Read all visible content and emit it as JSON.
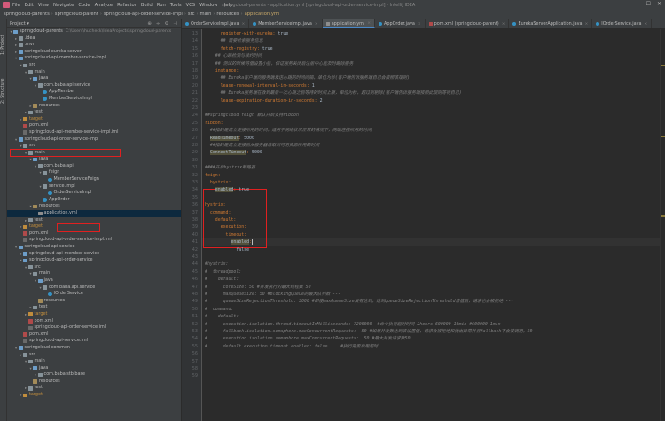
{
  "menu": {
    "items": [
      "File",
      "Edit",
      "View",
      "Navigate",
      "Code",
      "Analyze",
      "Refactor",
      "Build",
      "Run",
      "Tools",
      "VCS",
      "Window",
      "Help"
    ],
    "window_title": "springcloud-parents - application.yml [springcloud-api-order-service-impl] - IntelliJ IDEA",
    "controls": [
      "—",
      "☐",
      "✕"
    ]
  },
  "nav": {
    "crumbs": [
      "springcloud-parents",
      "springcloud-parent",
      "springcloud-api-order-service-impl",
      "src",
      "main",
      "resources",
      "application.yml"
    ]
  },
  "side": {
    "tabs": [
      "1: Project",
      "2: Structure"
    ]
  },
  "project": {
    "title": "Project ▾",
    "tools": [
      "⊕",
      "÷",
      "⚙",
      "⊣"
    ],
    "tree": [
      {
        "d": 0,
        "arr": "▾",
        "ic": "module",
        "label": "springcloud-parents",
        "gray": "C:\\Users\\hucheck\\IdeaProjects\\springcloud-parents"
      },
      {
        "d": 1,
        "arr": "▸",
        "ic": "folder",
        "label": ".idea"
      },
      {
        "d": 1,
        "arr": "▸",
        "ic": "folder",
        "label": ".mvn"
      },
      {
        "d": 1,
        "arr": "▸",
        "ic": "module",
        "label": "springcloud-eureka-server"
      },
      {
        "d": 1,
        "arr": "▾",
        "ic": "module",
        "label": "springcloud-api-member-service-impl"
      },
      {
        "d": 2,
        "arr": "▾",
        "ic": "folder",
        "label": "src"
      },
      {
        "d": 3,
        "arr": "▾",
        "ic": "folder",
        "label": "main"
      },
      {
        "d": 4,
        "arr": "▾",
        "ic": "src",
        "label": "java"
      },
      {
        "d": 5,
        "arr": "▾",
        "ic": "pkg",
        "label": "com.baba.api.service"
      },
      {
        "d": 6,
        "arr": "",
        "ic": "cls",
        "label": "AppMember"
      },
      {
        "d": 6,
        "arr": "",
        "ic": "cls",
        "label": "MemberServiceImpl"
      },
      {
        "d": 4,
        "arr": "▸",
        "ic": "res",
        "label": "resources"
      },
      {
        "d": 3,
        "arr": "▸",
        "ic": "folder",
        "label": "test"
      },
      {
        "d": 2,
        "arr": "▸",
        "ic": "tgt",
        "label": "target",
        "orange": true
      },
      {
        "d": 2,
        "arr": "",
        "ic": "pom",
        "label": "pom.xml"
      },
      {
        "d": 2,
        "arr": "",
        "ic": "iml",
        "label": "springcloud-api-member-service-impl.iml"
      },
      {
        "d": 1,
        "arr": "▾",
        "ic": "module",
        "label": "springcloud-api-order-service-impl",
        "sel": true
      },
      {
        "d": 2,
        "arr": "▾",
        "ic": "folder",
        "label": "src"
      },
      {
        "d": 3,
        "arr": "▾",
        "ic": "folder",
        "label": "main"
      },
      {
        "d": 4,
        "arr": "▾",
        "ic": "src",
        "label": "java"
      },
      {
        "d": 5,
        "arr": "▾",
        "ic": "pkg",
        "label": "com.baba.api"
      },
      {
        "d": 6,
        "arr": "▾",
        "ic": "pkg",
        "label": "feign"
      },
      {
        "d": 7,
        "arr": "",
        "ic": "cls",
        "label": "MemberServiceFeign"
      },
      {
        "d": 6,
        "arr": "▾",
        "ic": "pkg",
        "label": "service.impl"
      },
      {
        "d": 7,
        "arr": "",
        "ic": "cls",
        "label": "OrderServiceImpl"
      },
      {
        "d": 6,
        "arr": "",
        "ic": "cls",
        "label": "AppOrder"
      },
      {
        "d": 4,
        "arr": "▾",
        "ic": "res",
        "label": "resources"
      },
      {
        "d": 5,
        "arr": "",
        "ic": "yml",
        "label": "application.yml",
        "cur": true
      },
      {
        "d": 3,
        "arr": "▸",
        "ic": "folder",
        "label": "test"
      },
      {
        "d": 2,
        "arr": "▸",
        "ic": "tgt",
        "label": "target",
        "orange": true
      },
      {
        "d": 2,
        "arr": "",
        "ic": "pom",
        "label": "pom.xml"
      },
      {
        "d": 2,
        "arr": "",
        "ic": "iml",
        "label": "springcloud-api-order-service-impl.iml"
      },
      {
        "d": 1,
        "arr": "▾",
        "ic": "module",
        "label": "springcloud-api-service"
      },
      {
        "d": 2,
        "arr": "▸",
        "ic": "module",
        "label": "springcloud-api-member-service"
      },
      {
        "d": 2,
        "arr": "▾",
        "ic": "module",
        "label": "springcloud-api-order-service"
      },
      {
        "d": 3,
        "arr": "▾",
        "ic": "folder",
        "label": "src"
      },
      {
        "d": 4,
        "arr": "▾",
        "ic": "folder",
        "label": "main"
      },
      {
        "d": 5,
        "arr": "▾",
        "ic": "src",
        "label": "java"
      },
      {
        "d": 6,
        "arr": "▾",
        "ic": "pkg",
        "label": "com.baba.api.service"
      },
      {
        "d": 7,
        "arr": "",
        "ic": "cls",
        "label": "IOrderService"
      },
      {
        "d": 5,
        "arr": "",
        "ic": "res",
        "label": "resources"
      },
      {
        "d": 4,
        "arr": "▸",
        "ic": "folder",
        "label": "test"
      },
      {
        "d": 3,
        "arr": "▸",
        "ic": "tgt",
        "label": "target",
        "orange": true
      },
      {
        "d": 3,
        "arr": "",
        "ic": "pom",
        "label": "pom.xml"
      },
      {
        "d": 3,
        "arr": "",
        "ic": "iml",
        "label": "springcloud-api-order-service.iml"
      },
      {
        "d": 2,
        "arr": "",
        "ic": "pom",
        "label": "pom.xml"
      },
      {
        "d": 2,
        "arr": "",
        "ic": "iml",
        "label": "springcloud-api-service.iml"
      },
      {
        "d": 1,
        "arr": "▾",
        "ic": "module",
        "label": "springcloud-common"
      },
      {
        "d": 2,
        "arr": "▾",
        "ic": "folder",
        "label": "src"
      },
      {
        "d": 3,
        "arr": "▾",
        "ic": "folder",
        "label": "main"
      },
      {
        "d": 4,
        "arr": "▾",
        "ic": "src",
        "label": "java"
      },
      {
        "d": 5,
        "arr": "▸",
        "ic": "pkg",
        "label": "com.baba.stb.base"
      },
      {
        "d": 4,
        "arr": "",
        "ic": "res",
        "label": "resources"
      },
      {
        "d": 3,
        "arr": "▸",
        "ic": "folder",
        "label": "test"
      },
      {
        "d": 2,
        "arr": "▸",
        "ic": "tgt",
        "label": "target",
        "orange": true
      }
    ]
  },
  "tabs": [
    {
      "label": "OrderServiceImpl.java",
      "kind": "cls"
    },
    {
      "label": "MemberServiceImpl.java",
      "kind": "cls"
    },
    {
      "label": "application.yml",
      "kind": "yml",
      "active": true
    },
    {
      "label": "AppOrder.java",
      "kind": "cls"
    },
    {
      "label": "pom.xml (springcloud-parent)",
      "kind": "pom"
    },
    {
      "label": "EurekaServerApplication.java",
      "kind": "cls"
    },
    {
      "label": "IOrderService.java",
      "kind": "cls"
    }
  ],
  "editor": {
    "current_line": 41,
    "lines": [
      {
        "n": 13,
        "s": [
          {
            "t": "      register-with-eureka: ",
            "c": "key"
          },
          {
            "t": "true",
            "c": "val"
          }
        ]
      },
      {
        "n": 14,
        "s": [
          {
            "t": "      ## 需要检索服务信息",
            "c": "cmt"
          }
        ]
      },
      {
        "n": 15,
        "s": [
          {
            "t": "      fetch-registry: ",
            "c": "key"
          },
          {
            "t": "true",
            "c": "val"
          }
        ]
      },
      {
        "n": 16,
        "s": [
          {
            "t": "    ## 心跳检测与续约时间",
            "c": "cmt"
          }
        ]
      },
      {
        "n": 17,
        "s": [
          {
            "t": "    ## 测试的时候将值设置小些，保证服务关闭后注册中心能及时踢除服务",
            "c": "cmt"
          }
        ]
      },
      {
        "n": 18,
        "s": [
          {
            "t": "    instance:",
            "c": "key"
          }
        ]
      },
      {
        "n": 19,
        "s": [
          {
            "t": "      ## Eureka客户端向服务端发送心跳的时间间隔，单位为秒(客户端告诉服务端自己会按照该规则)",
            "c": "cmt"
          }
        ]
      },
      {
        "n": 20,
        "s": [
          {
            "t": "      lease-renewal-interval-in-seconds: ",
            "c": "key"
          },
          {
            "t": "1",
            "c": "val"
          }
        ]
      },
      {
        "n": 21,
        "s": [
          {
            "t": "      ## Eureka服务端在收到最后一次心跳之后等待的时间上限，单位为秒，超过则剔除(客户端告诉服务端按照此规则等待自己)",
            "c": "cmt"
          }
        ]
      },
      {
        "n": 22,
        "s": [
          {
            "t": "      lease-expiration-duration-in-seconds: ",
            "c": "key"
          },
          {
            "t": "2",
            "c": "val"
          }
        ]
      },
      {
        "n": 23,
        "s": []
      },
      {
        "n": 24,
        "s": [
          {
            "t": "##springcloud feign 默认开启支持ribbon",
            "c": "cmt"
          }
        ]
      },
      {
        "n": 25,
        "s": [
          {
            "t": "ribbon:",
            "c": "key"
          }
        ]
      },
      {
        "n": 26,
        "s": [
          {
            "t": "  ##指的是建立连接所用的时间，适用于网络状况正常的情况下，两端连接所用的时间",
            "c": "cmt"
          }
        ]
      },
      {
        "n": 27,
        "s": [
          {
            "t": "  ",
            "c": "val"
          },
          {
            "t": "ReadTimeout",
            "c": "hl"
          },
          {
            "t": ": ",
            "c": "key"
          },
          {
            "t": "5000",
            "c": "val"
          }
        ]
      },
      {
        "n": 28,
        "s": [
          {
            "t": "  ##指的是建立连接后从服务器读取到可用资源所用的时间",
            "c": "cmt"
          }
        ]
      },
      {
        "n": 29,
        "s": [
          {
            "t": "  ",
            "c": "val"
          },
          {
            "t": "ConnectTimeout",
            "c": "hl"
          },
          {
            "t": ": ",
            "c": "key"
          },
          {
            "t": "5000",
            "c": "val"
          }
        ]
      },
      {
        "n": 30,
        "s": []
      },
      {
        "n": 31,
        "s": [
          {
            "t": "####开启hystrix断路器",
            "c": "cmt"
          }
        ]
      },
      {
        "n": 32,
        "s": [
          {
            "t": "feign:",
            "c": "key"
          }
        ]
      },
      {
        "n": 33,
        "s": [
          {
            "t": "  hystrix:",
            "c": "key"
          }
        ]
      },
      {
        "n": 34,
        "s": [
          {
            "t": "    ",
            "c": "val"
          },
          {
            "t": "enabled",
            "c": "hl"
          },
          {
            "t": ": ",
            "c": "key"
          },
          {
            "t": "true",
            "c": "val"
          }
        ]
      },
      {
        "n": 35,
        "s": []
      },
      {
        "n": 36,
        "s": [
          {
            "t": "hystrix:",
            "c": "key"
          }
        ]
      },
      {
        "n": 37,
        "s": [
          {
            "t": "  command:",
            "c": "key"
          }
        ]
      },
      {
        "n": 38,
        "s": [
          {
            "t": "    default:",
            "c": "key"
          }
        ]
      },
      {
        "n": 39,
        "s": [
          {
            "t": "      execution:",
            "c": "key"
          }
        ]
      },
      {
        "n": 40,
        "s": [
          {
            "t": "        timeout:",
            "c": "key"
          }
        ]
      },
      {
        "n": 41,
        "s": [
          {
            "t": "          ",
            "c": "val"
          },
          {
            "t": "enabled",
            "c": "hl"
          },
          {
            "t": ":",
            "c": "key"
          },
          {
            "caret": true
          }
        ]
      },
      {
        "n": 42,
        "s": [
          {
            "t": "            false",
            "c": "val"
          }
        ]
      },
      {
        "n": 43,
        "s": []
      },
      {
        "n": 44,
        "s": [
          {
            "t": "#hystrix:",
            "c": "cmt"
          }
        ]
      },
      {
        "n": 45,
        "s": [
          {
            "t": "#  threadpool:",
            "c": "cmt"
          }
        ]
      },
      {
        "n": 46,
        "s": [
          {
            "t": "#    default:",
            "c": "cmt"
          }
        ]
      },
      {
        "n": 47,
        "s": [
          {
            "t": "#      coreSize: 50 #并发执行的最大线程数 50",
            "c": "cmt"
          }
        ]
      },
      {
        "n": 48,
        "s": [
          {
            "t": "#      maxQueueSize: 50 #BlockingQueue的最大队列数 ---",
            "c": "cmt"
          }
        ]
      },
      {
        "n": 49,
        "s": [
          {
            "t": "#      queueSizeRejectionThreshold: 3000 #即使maxQueueSize没有达到，达到queueSizeRejectionThreshold该值后，请求也会被拒绝 ---",
            "c": "cmt"
          }
        ]
      },
      {
        "n": 50,
        "s": [
          {
            "t": "#  command:",
            "c": "cmt"
          }
        ]
      },
      {
        "n": 51,
        "s": [
          {
            "t": "#    default:",
            "c": "cmt"
          }
        ]
      },
      {
        "n": 52,
        "s": [
          {
            "t": "#      execution.isolation.thread.timeoutInMilliseconds: 7200000  #命令执行超时时间 2hours 600000 10min #600000 1min",
            "c": "cmt"
          }
        ]
      },
      {
        "n": 53,
        "s": [
          {
            "t": "#      fallback.isolation.semaphore.maxConcurrentRequests:  50 #如果并发数达到该设置值，请求会被拒绝和抛出异常并且fallback不会被调用。50",
            "c": "cmt"
          }
        ]
      },
      {
        "n": 54,
        "s": [
          {
            "t": "#      execution.isolation.semaphore.maxConcurrentRequests:  50 #最大并发请求数50",
            "c": "cmt"
          }
        ]
      },
      {
        "n": 55,
        "s": [
          {
            "t": "#      default.execution.timeout.enabled: false     #执行是否启用超时",
            "c": "cmt"
          }
        ]
      },
      {
        "n": 56,
        "s": []
      },
      {
        "n": 57,
        "s": []
      },
      {
        "n": 58,
        "s": []
      },
      {
        "n": 59,
        "s": []
      }
    ]
  }
}
